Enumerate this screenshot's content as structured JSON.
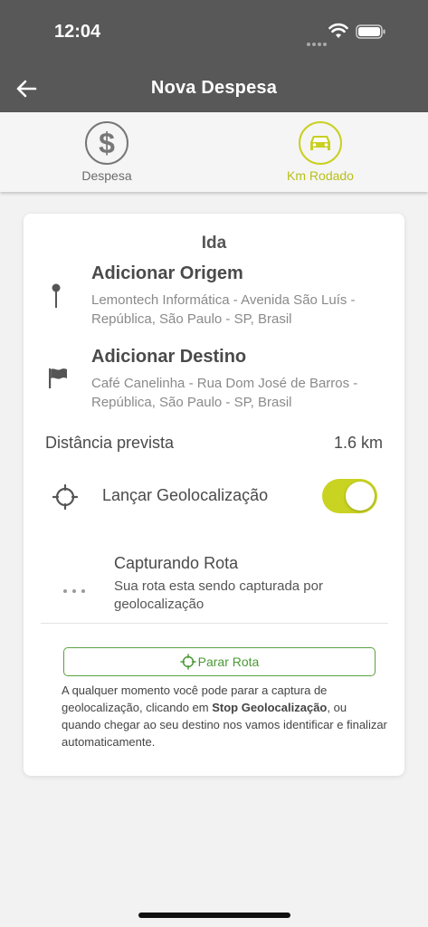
{
  "status_bar": {
    "time": "12:04"
  },
  "nav": {
    "title": "Nova Despesa"
  },
  "tabs": [
    {
      "label": "Despesa",
      "icon": "dollar-icon",
      "active": false
    },
    {
      "label": "Km Rodado",
      "icon": "car-icon",
      "active": true
    }
  ],
  "card": {
    "title": "Ida",
    "origin": {
      "label": "Adicionar Origem",
      "address": "Lemontech Informática - Avenida São Luís - República, São Paulo - SP, Brasil"
    },
    "destination": {
      "label": "Adicionar Destino",
      "address": "Café Canelinha - Rua Dom José de Barros - República, São Paulo - SP, Brasil"
    },
    "distance": {
      "label": "Distância prevista",
      "value": "1.6 km"
    },
    "geolocation": {
      "label": "Lançar Geolocalização",
      "enabled": true
    },
    "capture": {
      "title": "Capturando Rota",
      "description": "Sua rota esta sendo capturada por geolocalização"
    },
    "stop_button": {
      "label": "Parar Rota"
    },
    "info": {
      "before": "A qualquer momento você pode parar a captura de geolocalização, clicando em ",
      "bold": "Stop Geolocalização",
      "after": ", ou quando chegar ao seu destino nos vamos identificar e finalizar automaticamente."
    }
  },
  "colors": {
    "header": "#585858",
    "accent": "#c9d321",
    "accent_text": "#b8c017",
    "button_green": "#5aa142",
    "background": "#f2f2f2"
  }
}
